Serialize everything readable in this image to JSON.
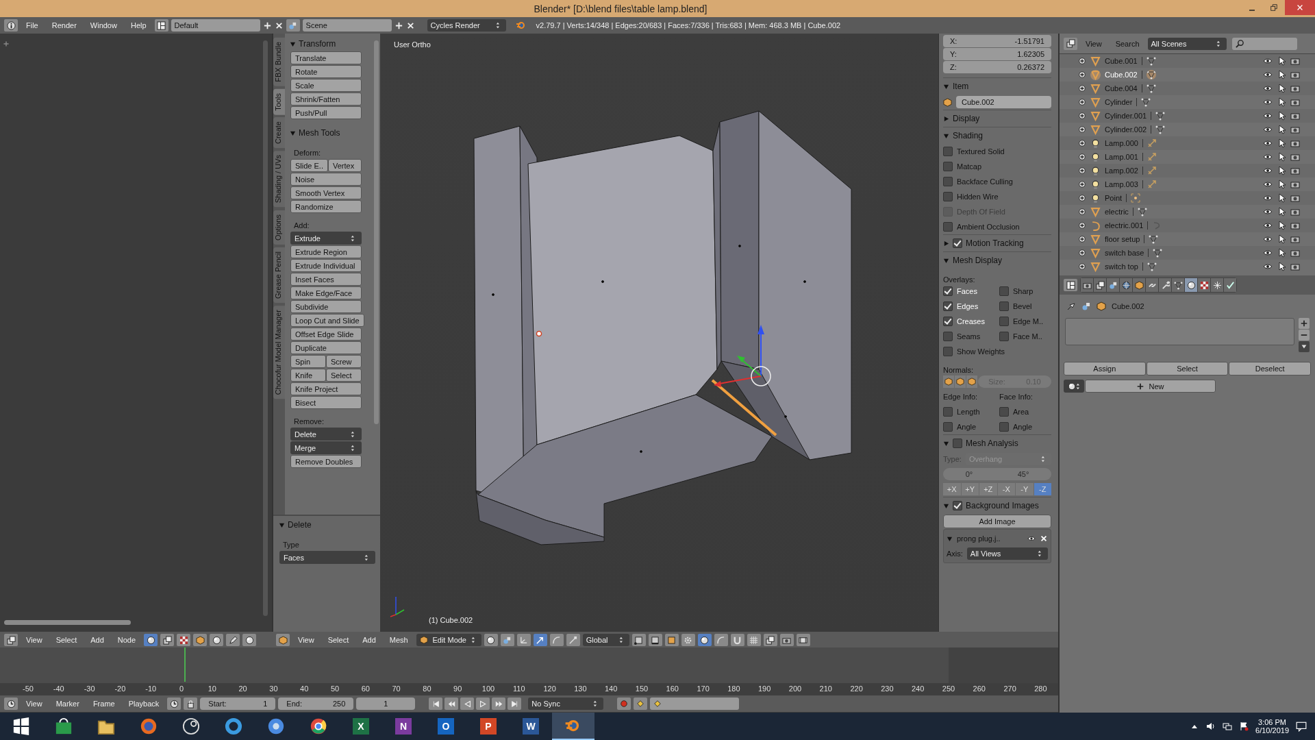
{
  "window": {
    "title": "Blender* [D:\\blend files\\table lamp.blend]"
  },
  "info_header": {
    "menus": [
      "File",
      "Render",
      "Window",
      "Help"
    ],
    "screen_layout": "Default",
    "scene": "Scene",
    "render_engine": "Cycles Render",
    "stats": "v2.79.7 | Verts:14/348 | Edges:20/683 | Faces:7/336 | Tris:683 | Mem: 468.3 MB | Cube.002"
  },
  "tool_shelf": {
    "tabs": [
      {
        "label": "FBX Bundle",
        "selected": false
      },
      {
        "label": "Tools",
        "selected": true
      },
      {
        "label": "Create",
        "selected": false
      },
      {
        "label": "Shading / UVs",
        "selected": false
      },
      {
        "label": "Options",
        "selected": false
      },
      {
        "label": "Grease Pencil",
        "selected": false
      },
      {
        "label": "Chocofur Model Manager",
        "selected": false
      }
    ],
    "panels": [
      {
        "title": "Transform",
        "expanded": true,
        "rows": [
          {
            "kind": "buttons",
            "labels": [
              "Translate"
            ]
          },
          {
            "kind": "buttons",
            "labels": [
              "Rotate"
            ]
          },
          {
            "kind": "buttons",
            "labels": [
              "Scale"
            ]
          },
          {
            "kind": "buttons",
            "labels": [
              "Shrink/Fatten"
            ]
          },
          {
            "kind": "buttons",
            "labels": [
              "Push/Pull"
            ]
          }
        ]
      },
      {
        "title": "Mesh Tools",
        "expanded": true,
        "rows": [
          {
            "kind": "label",
            "text": "Deform:"
          },
          {
            "kind": "buttons",
            "labels": [
              "Slide E..",
              "Vertex"
            ]
          },
          {
            "kind": "buttons",
            "labels": [
              "Noise"
            ]
          },
          {
            "kind": "buttons",
            "labels": [
              "Smooth Vertex"
            ]
          },
          {
            "kind": "buttons",
            "labels": [
              "Randomize"
            ]
          },
          {
            "kind": "label",
            "text": "Add:"
          },
          {
            "kind": "dropdown",
            "text": "Extrude"
          },
          {
            "kind": "buttons",
            "labels": [
              "Extrude Region"
            ]
          },
          {
            "kind": "buttons",
            "labels": [
              "Extrude Individual"
            ]
          },
          {
            "kind": "buttons",
            "labels": [
              "Inset Faces"
            ]
          },
          {
            "kind": "buttons",
            "labels": [
              "Make Edge/Face"
            ]
          },
          {
            "kind": "buttons",
            "labels": [
              "Subdivide"
            ]
          },
          {
            "kind": "buttons",
            "labels": [
              "Loop Cut and Slide"
            ]
          },
          {
            "kind": "buttons",
            "labels": [
              "Offset Edge Slide"
            ]
          },
          {
            "kind": "buttons",
            "labels": [
              "Duplicate"
            ]
          },
          {
            "kind": "buttons",
            "labels": [
              "Spin",
              "Screw"
            ]
          },
          {
            "kind": "buttons",
            "labels": [
              "Knife",
              "Select"
            ]
          },
          {
            "kind": "buttons",
            "labels": [
              "Knife Project"
            ]
          },
          {
            "kind": "buttons",
            "labels": [
              "Bisect"
            ]
          },
          {
            "kind": "label",
            "text": "Remove:"
          },
          {
            "kind": "dropdown",
            "text": "Delete"
          },
          {
            "kind": "dropdown",
            "text": "Merge"
          },
          {
            "kind": "buttons",
            "labels": [
              "Remove Doubles"
            ]
          }
        ]
      }
    ],
    "operator_panel": {
      "title": "Delete",
      "expanded": true,
      "rows": [
        {
          "kind": "label",
          "text": "Type"
        },
        {
          "kind": "dropdown",
          "text": "Faces"
        }
      ]
    }
  },
  "viewport": {
    "view_name": "User Ortho",
    "object_label": "(1) Cube.002"
  },
  "node_editor_header": {
    "menus": [
      "View",
      "Select",
      "Add",
      "Node"
    ],
    "tools": [
      {
        "kind": "sphere",
        "selected": true
      },
      {
        "kind": "layers",
        "selected": false
      },
      {
        "kind": "checker",
        "selected": false
      },
      {
        "kind": "cube",
        "selected": false
      },
      {
        "kind": "sphere",
        "selected": false
      },
      {
        "kind": "pencil",
        "selected": false
      },
      {
        "kind": "sphere",
        "selected": false
      }
    ]
  },
  "view3d_header": {
    "menus": [
      "View",
      "Select",
      "Add",
      "Mesh"
    ],
    "mode": "Edit Mode",
    "orientation": "Global",
    "tools_before": [
      {
        "kind": "sphere",
        "selected": false
      },
      {
        "kind": "scene",
        "selected": false
      },
      {
        "kind": "axes",
        "selected": false
      },
      {
        "kind": "arrow",
        "selected": true
      },
      {
        "kind": "arc",
        "selected": false
      },
      {
        "kind": "scale",
        "selected": false
      }
    ],
    "tools_after": [
      {
        "kind": "vertex",
        "selected": false
      },
      {
        "kind": "edge",
        "selected": false
      },
      {
        "kind": "face",
        "selected": false
      },
      {
        "kind": "gear",
        "selected": false
      },
      {
        "kind": "sphere",
        "selected": true
      },
      {
        "kind": "arc",
        "selected": false
      },
      {
        "kind": "magnet",
        "selected": false
      },
      {
        "kind": "grid",
        "selected": false
      },
      {
        "kind": "layers",
        "selected": false
      },
      {
        "kind": "camera",
        "selected": false
      },
      {
        "kind": "film",
        "selected": false
      }
    ]
  },
  "properties_region": {
    "transform_fields": [
      {
        "label": "X:",
        "value": "-1.51791"
      },
      {
        "label": "Y:",
        "value": "1.62305"
      },
      {
        "label": "Z:",
        "value": "0.26372"
      }
    ],
    "panels": [
      {
        "title": "Item",
        "expanded": true,
        "rows": [
          {
            "kind": "name_field",
            "value": "Cube.002"
          }
        ]
      },
      {
        "title": "Display",
        "expanded": false
      },
      {
        "title": "Shading",
        "expanded": true,
        "rows": [
          {
            "kind": "check",
            "text": "Textured Solid",
            "checked": false,
            "disabled": false
          },
          {
            "kind": "check",
            "text": "Matcap",
            "checked": false,
            "disabled": false
          },
          {
            "kind": "check",
            "text": "Backface Culling",
            "checked": false,
            "disabled": false
          },
          {
            "kind": "check",
            "text": "Hidden Wire",
            "checked": false,
            "disabled": false
          },
          {
            "kind": "check",
            "text": "Depth Of Field",
            "checked": false,
            "disabled": true
          },
          {
            "kind": "check",
            "text": "Ambient Occlusion",
            "checked": false,
            "disabled": false
          }
        ]
      },
      {
        "title": "Motion Tracking",
        "expanded": false,
        "checked": true
      },
      {
        "title": "Mesh Display",
        "expanded": true,
        "rows": [
          {
            "kind": "label",
            "text": "Overlays:"
          },
          {
            "kind": "check_pair",
            "items": [
              {
                "text": "Faces",
                "checked": true
              },
              {
                "text": "Sharp",
                "checked": false
              }
            ]
          },
          {
            "kind": "check_pair",
            "items": [
              {
                "text": "Edges",
                "checked": true
              },
              {
                "text": "Bevel",
                "checked": false
              }
            ]
          },
          {
            "kind": "check_pair",
            "items": [
              {
                "text": "Creases",
                "checked": true
              },
              {
                "text": "Edge M..",
                "checked": false
              }
            ]
          },
          {
            "kind": "check_pair",
            "items": [
              {
                "text": "Seams",
                "checked": false
              },
              {
                "text": "Face M..",
                "checked": false
              }
            ]
          },
          {
            "kind": "check",
            "text": "Show Weights",
            "checked": false,
            "disabled": false
          },
          {
            "kind": "label",
            "text": "Normals:"
          },
          {
            "kind": "normals",
            "size_label": "Size:",
            "size": "0.10"
          },
          {
            "kind": "label_pair",
            "texts": [
              "Edge Info:",
              "Face Info:"
            ]
          },
          {
            "kind": "check_pair",
            "items": [
              {
                "text": "Length",
                "checked": false
              },
              {
                "text": "Area",
                "checked": false
              }
            ]
          },
          {
            "kind": "check_pair",
            "items": [
              {
                "text": "Angle",
                "checked": false
              },
              {
                "text": "Angle",
                "checked": false
              }
            ]
          }
        ]
      },
      {
        "title": "Mesh Analysis",
        "expanded": true,
        "checked": false,
        "rows": [
          {
            "kind": "select",
            "label": "Type:",
            "value": "Overhang",
            "disabled": true
          },
          {
            "kind": "range",
            "values": [
              "0°",
              "45°"
            ]
          },
          {
            "kind": "toggles",
            "items": [
              {
                "text": "+X",
                "selected": false
              },
              {
                "text": "+Y",
                "selected": false
              },
              {
                "text": "+Z",
                "selected": false
              },
              {
                "text": "-X",
                "selected": false
              },
              {
                "text": "-Y",
                "selected": false
              },
              {
                "text": "-Z",
                "selected": true
              }
            ]
          }
        ]
      },
      {
        "title": "Background Images",
        "expanded": true,
        "checked": true,
        "rows": [
          {
            "kind": "button",
            "text": "Add Image"
          },
          {
            "kind": "image_slot",
            "name": "prong plug.j..",
            "axis_label": "Axis:",
            "axis": "All Views"
          }
        ]
      }
    ]
  },
  "outliner": {
    "menus": [
      "View",
      "Search"
    ],
    "display_mode": "All Scenes",
    "items": [
      {
        "name": "Cube.001",
        "kind": "mesh",
        "selected": false
      },
      {
        "name": "Cube.002",
        "kind": "mesh",
        "selected": true
      },
      {
        "name": "Cube.004",
        "kind": "mesh",
        "selected": false
      },
      {
        "name": "Cylinder",
        "kind": "mesh",
        "selected": false
      },
      {
        "name": "Cylinder.001",
        "kind": "mesh",
        "selected": false
      },
      {
        "name": "Cylinder.002",
        "kind": "mesh",
        "selected": false
      },
      {
        "name": "Lamp.000",
        "kind": "lamp",
        "selected": false
      },
      {
        "name": "Lamp.001",
        "kind": "lamp",
        "selected": false
      },
      {
        "name": "Lamp.002",
        "kind": "lamp",
        "selected": false
      },
      {
        "name": "Lamp.003",
        "kind": "lamp",
        "selected": false
      },
      {
        "name": "Point",
        "kind": "point_lamp",
        "selected": false
      },
      {
        "name": "electric",
        "kind": "mesh",
        "selected": false
      },
      {
        "name": "electric.001",
        "kind": "curve",
        "selected": false
      },
      {
        "name": "floor setup",
        "kind": "mesh",
        "selected": false
      },
      {
        "name": "switch base",
        "kind": "mesh",
        "selected": false
      },
      {
        "name": "switch top",
        "kind": "mesh",
        "selected": false
      }
    ]
  },
  "properties_editor": {
    "tabs": [
      {
        "kind": "render",
        "selected": false
      },
      {
        "kind": "layers",
        "selected": false
      },
      {
        "kind": "scene",
        "selected": false
      },
      {
        "kind": "world",
        "selected": false
      },
      {
        "kind": "object",
        "selected": false
      },
      {
        "kind": "constraints",
        "selected": false
      },
      {
        "kind": "modifiers",
        "selected": false
      },
      {
        "kind": "data",
        "selected": false
      },
      {
        "kind": "material",
        "selected": true
      },
      {
        "kind": "texture",
        "selected": false
      },
      {
        "kind": "particles",
        "selected": false
      },
      {
        "kind": "physics",
        "selected": false
      }
    ],
    "breadcrumb": "Cube.002",
    "slot_buttons": [
      "Assign",
      "Select",
      "Deselect"
    ],
    "new_button": "New"
  },
  "timeline": {
    "ruler": [
      "-50",
      "-40",
      "-30",
      "-20",
      "-10",
      "0",
      "10",
      "20",
      "30",
      "40",
      "50",
      "60",
      "70",
      "80",
      "90",
      "100",
      "110",
      "120",
      "130",
      "140",
      "150",
      "160",
      "170",
      "180",
      "190",
      "200",
      "210",
      "220",
      "230",
      "240",
      "250",
      "260",
      "270",
      "280"
    ],
    "header": {
      "menus": [
        "View",
        "Marker",
        "Frame",
        "Playback"
      ],
      "start_label": "Start:",
      "start": "1",
      "end_label": "End:",
      "end": "250",
      "frame": "1",
      "sync": "No Sync"
    }
  },
  "taskbar": {
    "apps": [
      {
        "kind": "squares",
        "selected": false
      },
      {
        "kind": "bag",
        "selected": false
      },
      {
        "kind": "folder",
        "selected": false
      },
      {
        "kind": "globe",
        "selected": false
      },
      {
        "kind": "disc",
        "selected": false
      },
      {
        "kind": "ring",
        "selected": false
      },
      {
        "kind": "circle",
        "selected": false
      },
      {
        "kind": "tricolor",
        "selected": false
      },
      {
        "kind": "tile",
        "letter": "X",
        "color": "#1e7145",
        "selected": false
      },
      {
        "kind": "tile",
        "letter": "N",
        "color": "#7b3b9e",
        "selected": false
      },
      {
        "kind": "tile",
        "letter": "O",
        "color": "#1565c0",
        "selected": false
      },
      {
        "kind": "tile",
        "letter": "P",
        "color": "#d24726",
        "selected": false
      },
      {
        "kind": "tile",
        "letter": "W",
        "color": "#2b5797",
        "selected": false
      },
      {
        "kind": "logo",
        "selected": true
      }
    ],
    "time": "3:06 PM",
    "date": "6/10/2019"
  }
}
